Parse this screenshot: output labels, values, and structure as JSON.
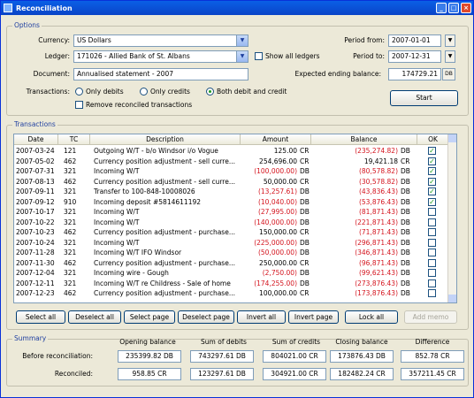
{
  "window": {
    "title": "Reconciliation"
  },
  "options": {
    "title": "Options",
    "currency_label": "Currency:",
    "currency_value": "US Dollars",
    "ledger_label": "Ledger:",
    "ledger_value": "171026 - Allied Bank of St. Albans",
    "show_all_ledgers_label": "Show all ledgers",
    "document_label": "Document:",
    "document_value": "Annualised statement - 2007",
    "period_from_label": "Period from:",
    "period_from_value": "2007-01-01",
    "period_to_label": "Period to:",
    "period_to_value": "2007-12-31",
    "expected_label": "Expected ending balance:",
    "expected_value": "174729.21",
    "expected_unit": "DB",
    "transactions_label": "Transactions:",
    "radio_debits": "Only debits",
    "radio_credits": "Only credits",
    "radio_both": "Both debit and credit",
    "remove_reconciled_label": "Remove reconciled transactions",
    "start_label": "Start"
  },
  "transactions": {
    "title": "Transactions",
    "columns": [
      "Date",
      "TC",
      "Description",
      "Amount",
      "Balance",
      "OK"
    ],
    "rows": [
      {
        "date": "2007-03-24",
        "tc": "121",
        "desc": "Outgoing W/T - b/o Windsor i/o Vogue",
        "amount": "125.00",
        "amount_type": "CR",
        "amount_neg": false,
        "balance": "(235,274.82)",
        "balance_type": "DB",
        "balance_neg": true,
        "ok": true
      },
      {
        "date": "2007-05-02",
        "tc": "462",
        "desc": "Currency position adjustment - sell curre...",
        "amount": "254,696.00",
        "amount_type": "CR",
        "amount_neg": false,
        "balance": "19,421.18",
        "balance_type": "CR",
        "balance_neg": false,
        "ok": true
      },
      {
        "date": "2007-07-31",
        "tc": "321",
        "desc": "Incoming W/T",
        "amount": "(100,000.00)",
        "amount_type": "DB",
        "amount_neg": true,
        "balance": "(80,578.82)",
        "balance_type": "DB",
        "balance_neg": true,
        "ok": true
      },
      {
        "date": "2007-08-13",
        "tc": "462",
        "desc": "Currency position adjustment - sell curre...",
        "amount": "50,000.00",
        "amount_type": "CR",
        "amount_neg": false,
        "balance": "(30,578.82)",
        "balance_type": "DB",
        "balance_neg": true,
        "ok": true
      },
      {
        "date": "2007-09-11",
        "tc": "321",
        "desc": "Transfer to 100-848-10008026",
        "amount": "(13,257.61)",
        "amount_type": "DB",
        "amount_neg": true,
        "balance": "(43,836.43)",
        "balance_type": "DB",
        "balance_neg": true,
        "ok": true
      },
      {
        "date": "2007-09-12",
        "tc": "910",
        "desc": "Incoming deposit #5814611192",
        "amount": "(10,040.00)",
        "amount_type": "DB",
        "amount_neg": true,
        "balance": "(53,876.43)",
        "balance_type": "DB",
        "balance_neg": true,
        "ok": true
      },
      {
        "date": "2007-10-17",
        "tc": "321",
        "desc": "Incoming W/T",
        "amount": "(27,995.00)",
        "amount_type": "DB",
        "amount_neg": true,
        "balance": "(81,871.43)",
        "balance_type": "DB",
        "balance_neg": true,
        "ok": false
      },
      {
        "date": "2007-10-22",
        "tc": "321",
        "desc": "Incoming W/T",
        "amount": "(140,000.00)",
        "amount_type": "DB",
        "amount_neg": true,
        "balance": "(221,871.43)",
        "balance_type": "DB",
        "balance_neg": true,
        "ok": false
      },
      {
        "date": "2007-10-23",
        "tc": "462",
        "desc": "Currency position adjustment - purchase...",
        "amount": "150,000.00",
        "amount_type": "CR",
        "amount_neg": false,
        "balance": "(71,871.43)",
        "balance_type": "DB",
        "balance_neg": true,
        "ok": false
      },
      {
        "date": "2007-10-24",
        "tc": "321",
        "desc": "Incoming W/T",
        "amount": "(225,000.00)",
        "amount_type": "DB",
        "amount_neg": true,
        "balance": "(296,871.43)",
        "balance_type": "DB",
        "balance_neg": true,
        "ok": false
      },
      {
        "date": "2007-11-28",
        "tc": "321",
        "desc": "Incoming W/T IFO Windsor",
        "amount": "(50,000.00)",
        "amount_type": "DB",
        "amount_neg": true,
        "balance": "(346,871.43)",
        "balance_type": "DB",
        "balance_neg": true,
        "ok": false
      },
      {
        "date": "2007-11-30",
        "tc": "462",
        "desc": "Currency position adjustment - purchase...",
        "amount": "250,000.00",
        "amount_type": "CR",
        "amount_neg": false,
        "balance": "(96,871.43)",
        "balance_type": "DB",
        "balance_neg": true,
        "ok": false
      },
      {
        "date": "2007-12-04",
        "tc": "321",
        "desc": "Incoming wire - Gough",
        "amount": "(2,750.00)",
        "amount_type": "DB",
        "amount_neg": true,
        "balance": "(99,621.43)",
        "balance_type": "DB",
        "balance_neg": true,
        "ok": false
      },
      {
        "date": "2007-12-11",
        "tc": "321",
        "desc": "Incoming W/T re Childress - Sale of home",
        "amount": "(174,255.00)",
        "amount_type": "DB",
        "amount_neg": true,
        "balance": "(273,876.43)",
        "balance_type": "DB",
        "balance_neg": true,
        "ok": false
      },
      {
        "date": "2007-12-23",
        "tc": "462",
        "desc": "Currency position adjustment - purchase...",
        "amount": "100,000.00",
        "amount_type": "CR",
        "amount_neg": false,
        "balance": "(173,876.43)",
        "balance_type": "DB",
        "balance_neg": true,
        "ok": false
      }
    ]
  },
  "buttons": {
    "select_all": "Select all",
    "deselect_all": "Deselect all",
    "select_page": "Select page",
    "deselect_page": "Deselect page",
    "invert_all": "Invert all",
    "invert_page": "Invert page",
    "lock_all": "Lock all",
    "add_memo": "Add memo"
  },
  "summary": {
    "title": "Summary",
    "headers": [
      "Opening balance",
      "Sum of debits",
      "Sum of credits",
      "Closing balance",
      "Difference"
    ],
    "before_label": "Before reconciliation:",
    "before": [
      "235399.82 DB",
      "743297.61 DB",
      "804021.00 CR",
      "173876.43 DB",
      "852.78 CR"
    ],
    "reconciled_label": "Reconciled:",
    "reconciled": [
      "958.85 CR",
      "123297.61 DB",
      "304921.00 CR",
      "182482.24 CR",
      "357211.45 CR"
    ]
  },
  "colors": {
    "negative": "#d4141e",
    "titlebar": "#0a5fe6",
    "check": "#1d9b1d"
  }
}
